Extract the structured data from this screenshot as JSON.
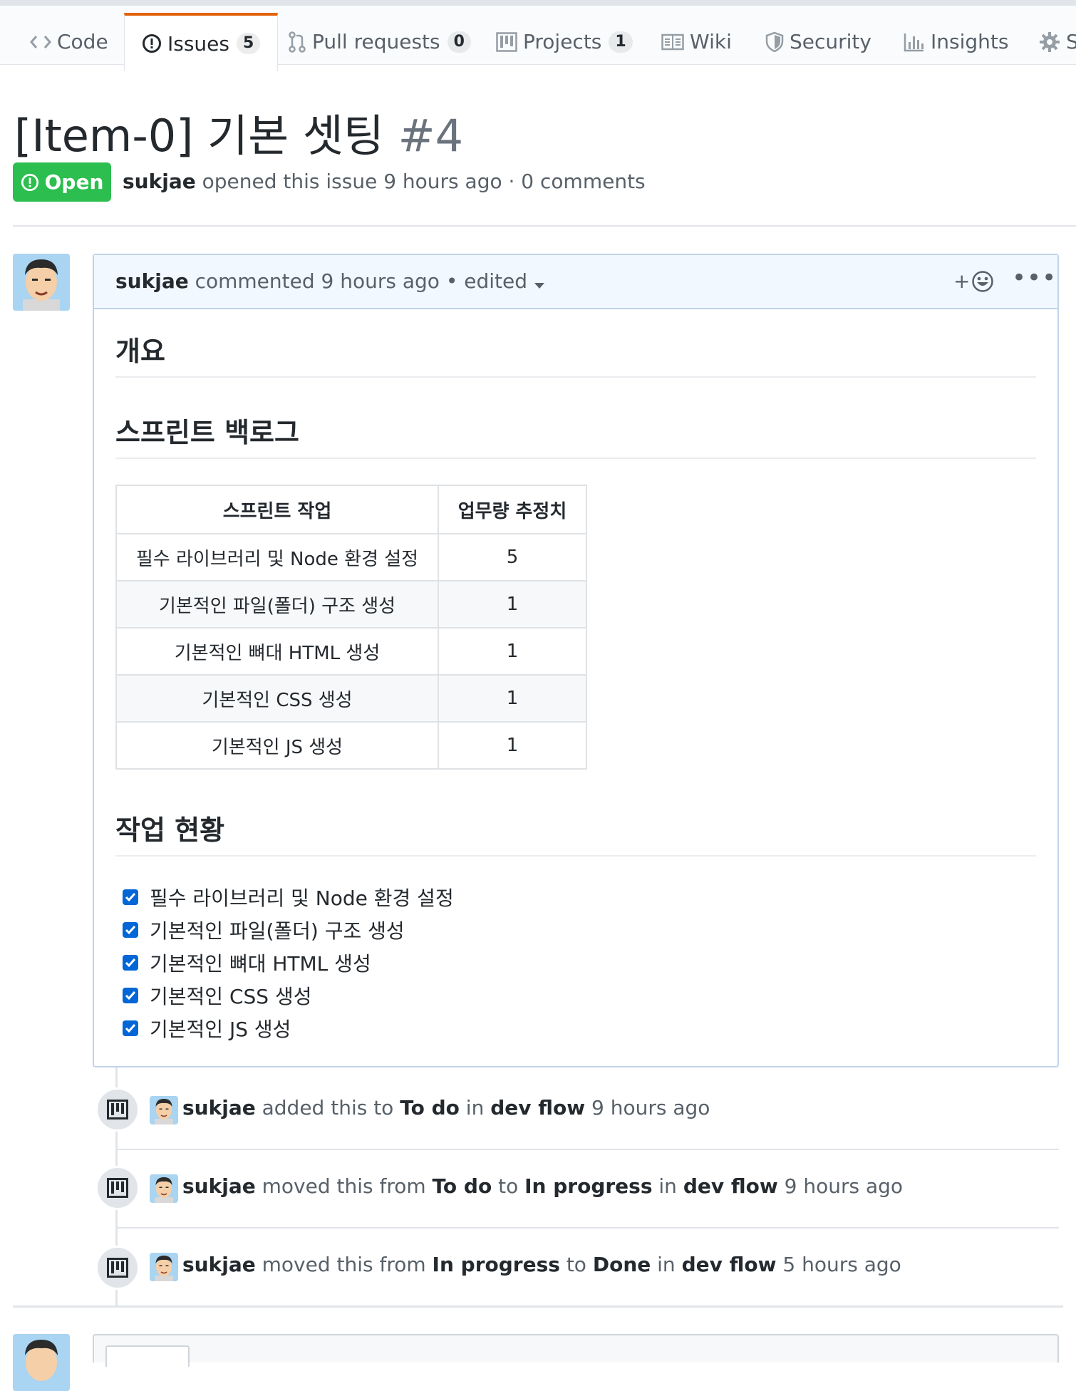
{
  "repo_tabs": {
    "code": "Code",
    "issues": "Issues",
    "issues_count": "5",
    "pulls": "Pull requests",
    "pulls_count": "0",
    "projects": "Projects",
    "projects_count": "1",
    "wiki": "Wiki",
    "security": "Security",
    "insights": "Insights",
    "settings_partial": "S"
  },
  "issue": {
    "title": "[Item-0] 기본 셋팅",
    "number": "#4",
    "state": "Open",
    "author": "sukjae",
    "meta_rest": "opened this issue 9 hours ago · 0 comments"
  },
  "comment": {
    "author": "sukjae",
    "action": "commented 9 hours ago",
    "edited": "• edited",
    "reaction_plus": "+"
  },
  "body": {
    "h_overview": "개요",
    "h_backlog": "스프린트 백로그",
    "table": {
      "headers": [
        "스프린트 작업",
        "업무량 추정치"
      ],
      "rows": [
        [
          "필수 라이브러리 및 Node 환경 설정",
          "5"
        ],
        [
          "기본적인 파일(폴더) 구조 생성",
          "1"
        ],
        [
          "기본적인 뼈대 HTML 생성",
          "1"
        ],
        [
          "기본적인 CSS 생성",
          "1"
        ],
        [
          "기본적인 JS 생성",
          "1"
        ]
      ]
    },
    "h_status": "작업 현황",
    "tasks": [
      "필수 라이브러리 및 Node 환경 설정",
      "기본적인 파일(폴더) 구조 생성",
      "기본적인 뼈대 HTML 생성",
      "기본적인 CSS 생성",
      "기본적인 JS 생성"
    ]
  },
  "timeline": [
    {
      "user": "sukjae",
      "p1": "added this to",
      "col1": "To do",
      "p2": "in",
      "project": "dev flow",
      "time": "9 hours ago"
    },
    {
      "user": "sukjae",
      "p1": "moved this from",
      "col1": "To do",
      "p2": "to",
      "col2": "In progress",
      "p3": "in",
      "project": "dev flow",
      "time": "9 hours ago"
    },
    {
      "user": "sukjae",
      "p1": "moved this from",
      "col1": "In progress",
      "p2": "to",
      "col2": "Done",
      "p3": "in",
      "project": "dev flow",
      "time": "5 hours ago"
    }
  ],
  "colors": {
    "accent_tab": "#e36209",
    "open_green": "#2cbe4e",
    "checkbox_blue": "#0366d6",
    "comment_header": "#f1f8ff"
  }
}
